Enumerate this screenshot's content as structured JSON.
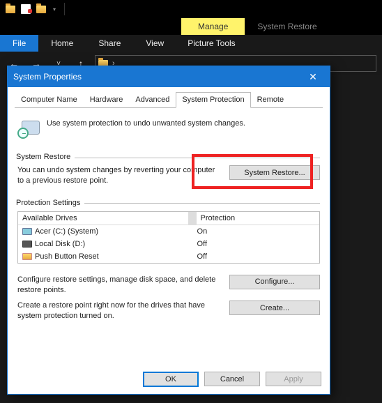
{
  "explorer": {
    "window_title": "System Restore",
    "manage_label": "Manage",
    "picture_tools": "Picture Tools",
    "menu": {
      "file": "File",
      "home": "Home",
      "share": "Share",
      "view": "View"
    }
  },
  "dialog": {
    "title": "System Properties",
    "description": "Use system protection to undo unwanted system changes.",
    "tabs": {
      "computer_name": "Computer Name",
      "hardware": "Hardware",
      "advanced": "Advanced",
      "system_protection": "System Protection",
      "remote": "Remote"
    },
    "restore": {
      "legend": "System Restore",
      "text": "You can undo system changes by reverting your computer to a previous restore point.",
      "button": "System Restore..."
    },
    "protection": {
      "legend": "Protection Settings",
      "col_drives": "Available Drives",
      "col_protection": "Protection",
      "drives": [
        {
          "name": "Acer (C:) (System)",
          "protection": "On",
          "icon": "disk"
        },
        {
          "name": "Local Disk (D:)",
          "protection": "Off",
          "icon": "disk-dark"
        },
        {
          "name": "Push Button Reset",
          "protection": "Off",
          "icon": "folder"
        }
      ],
      "configure_text": "Configure restore settings, manage disk space, and delete restore points.",
      "configure_btn": "Configure...",
      "create_text": "Create a restore point right now for the drives that have system protection turned on.",
      "create_btn": "Create..."
    },
    "buttons": {
      "ok": "OK",
      "cancel": "Cancel",
      "apply": "Apply"
    }
  }
}
